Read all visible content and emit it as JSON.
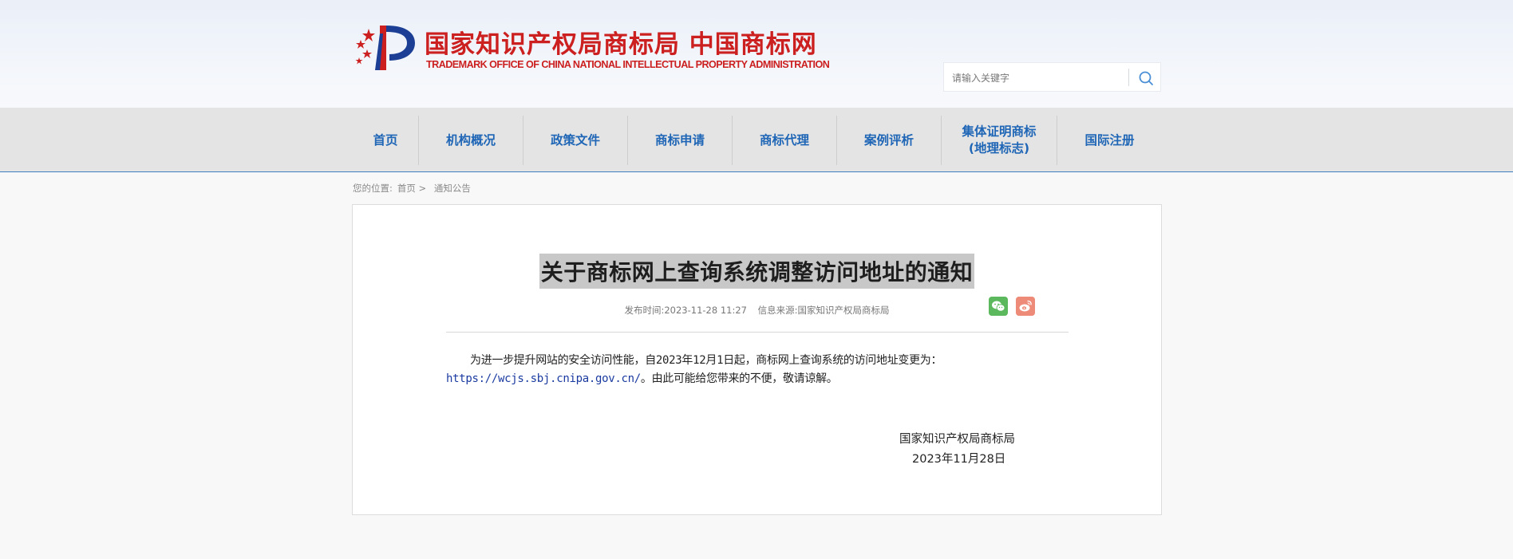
{
  "header": {
    "logo_cn": "国家知识产权局商标局 中国商标网",
    "logo_en": "TRADEMARK OFFICE OF CHINA NATIONAL INTELLECTUAL PROPERTY ADMINISTRATION",
    "logo_color": "#cc1f1f",
    "search": {
      "placeholder": "请输入关键字",
      "icon": "search-icon"
    }
  },
  "nav": {
    "items": [
      {
        "label": "首页"
      },
      {
        "label": "机构概况"
      },
      {
        "label": "政策文件"
      },
      {
        "label": "商标申请"
      },
      {
        "label": "商标代理"
      },
      {
        "label": "案例评析"
      },
      {
        "label_line1": "集体证明商标",
        "label_line2": "(地理标志)"
      },
      {
        "label": "国际注册"
      }
    ],
    "text_color": "#1f66b6"
  },
  "breadcrumb": {
    "prefix": "您的位置:",
    "home": "首页",
    "separator": ">",
    "current": "通知公告"
  },
  "article": {
    "title": "关于商标网上查询系统调整访问地址的通知",
    "publish_label": "发布时间:",
    "publish_time": "2023-11-28 11:27",
    "source_label": "信息来源:",
    "source": "国家知识产权局商标局",
    "share": {
      "wechat_icon": "wechat-icon",
      "weibo_icon": "weibo-icon",
      "wechat_color": "#5cb85c",
      "weibo_color": "#ee8a78"
    },
    "body_before": "为进一步提升网站的安全访问性能，自2023年12月1日起，商标网上查询系统的访问地址变更为：",
    "body_url": "https://wcjs.sbj.cnipa.gov.cn/",
    "body_after": "。由此可能给您带来的不便，敬请谅解。",
    "signature_org": "国家知识产权局商标局",
    "signature_date": "2023年11月28日"
  }
}
